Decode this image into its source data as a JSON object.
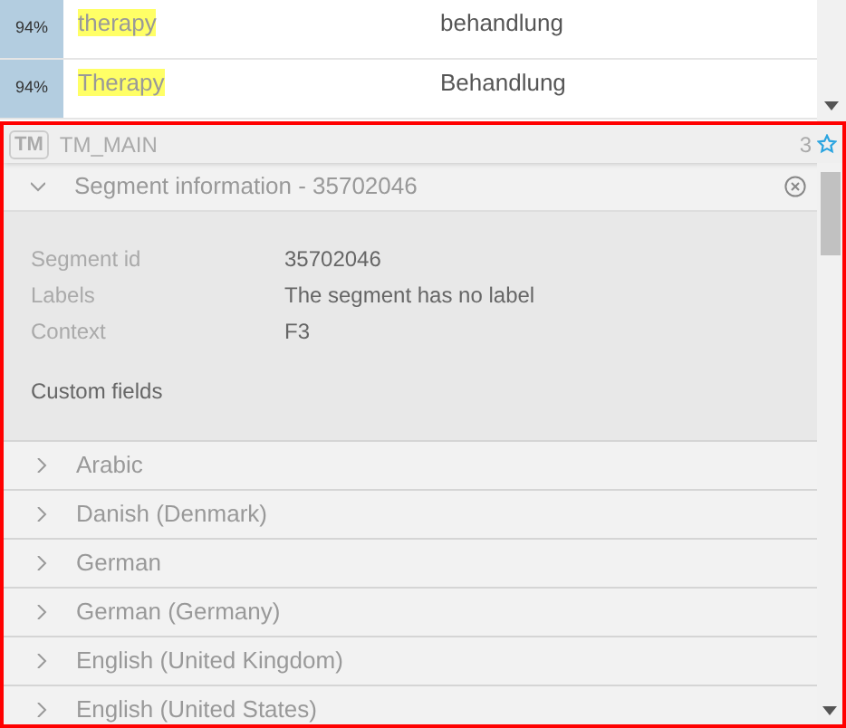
{
  "matches": [
    {
      "score": "94%",
      "source": "therapy",
      "target": "behandlung"
    },
    {
      "score": "94%",
      "source": "Therapy",
      "target": "Behandlung"
    }
  ],
  "tm": {
    "badge": "TM",
    "name": "TM_MAIN",
    "count": "3"
  },
  "segment_info": {
    "title": "Segment information - 35702046",
    "expanded": true,
    "fields": [
      {
        "label": "Segment id",
        "value": "35702046"
      },
      {
        "label": "Labels",
        "value": "The segment has no label"
      },
      {
        "label": "Context",
        "value": "F3"
      }
    ],
    "custom_fields": "Custom fields"
  },
  "languages": [
    {
      "name": "Arabic",
      "expanded": false
    },
    {
      "name": "Danish (Denmark)",
      "expanded": false
    },
    {
      "name": "German",
      "expanded": false
    },
    {
      "name": "German (Germany)",
      "expanded": false
    },
    {
      "name": "English (United Kingdom)",
      "expanded": false
    },
    {
      "name": "English (United States)",
      "expanded": false
    }
  ]
}
